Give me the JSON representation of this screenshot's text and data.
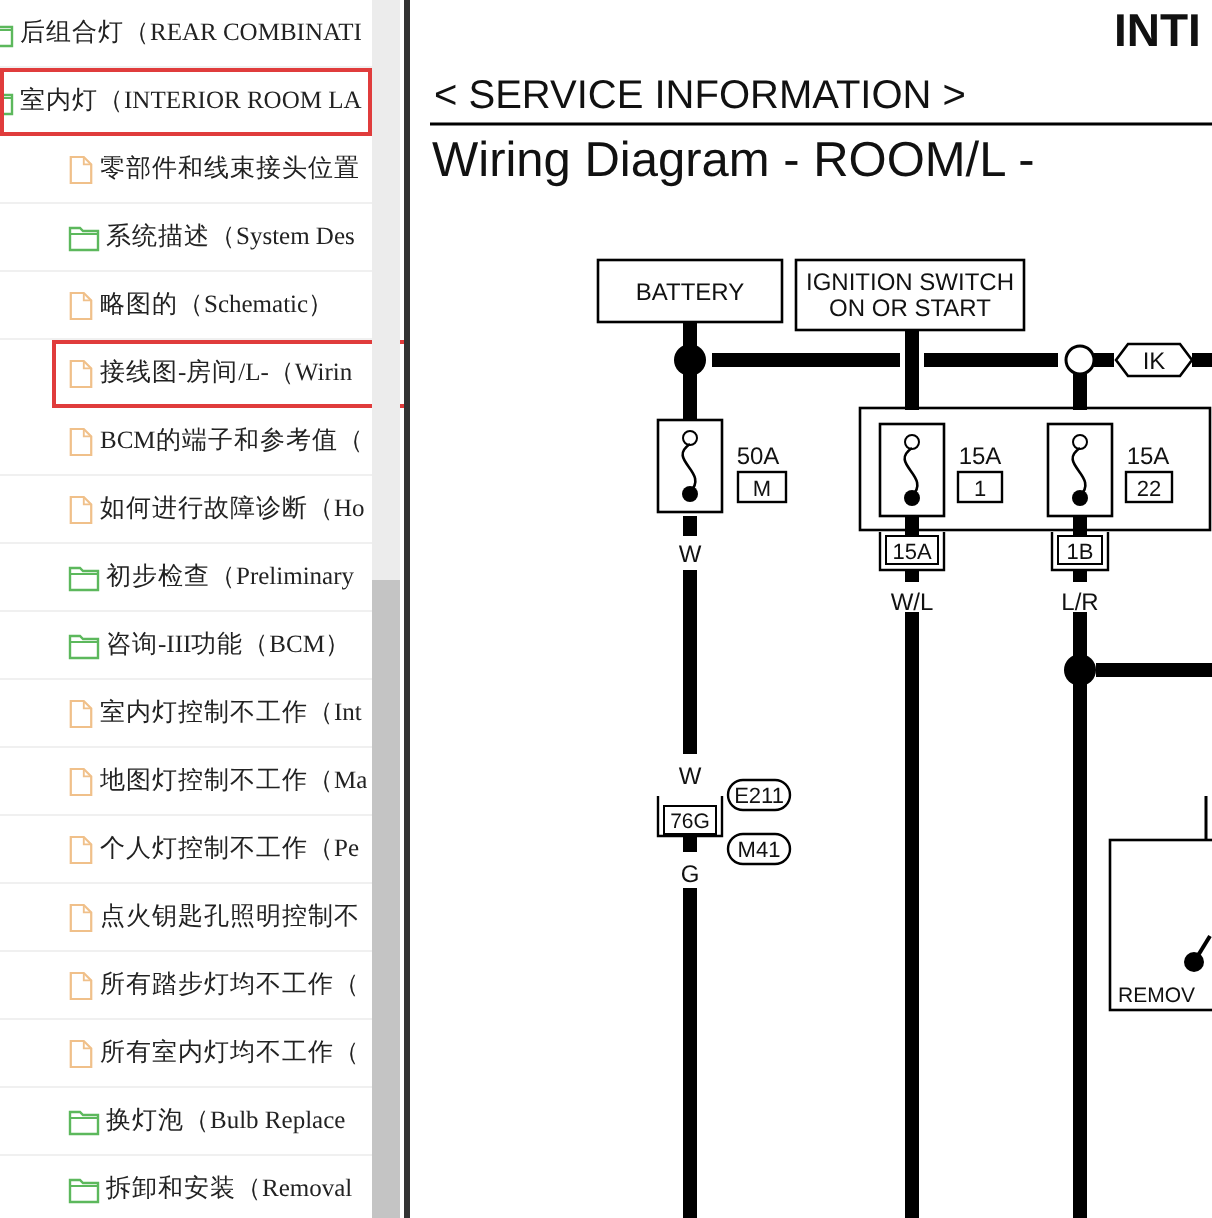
{
  "tree": [
    {
      "label": "后组合灯（REAR COMBINATI",
      "kind": "folder",
      "outlined": false
    },
    {
      "label": "室内灯（INTERIOR ROOM LA",
      "kind": "folder",
      "outlined": true,
      "children": [
        {
          "label": "零部件和线束接头位置",
          "kind": "document",
          "outlined": false
        },
        {
          "label": "系统描述（System Des",
          "kind": "folder",
          "outlined": false
        },
        {
          "label": "略图的（Schematic）",
          "kind": "document",
          "outlined": false
        },
        {
          "label": "接线图-房间/L-（Wirin",
          "kind": "document",
          "outlined": true
        },
        {
          "label": "BCM的端子和参考值（",
          "kind": "document",
          "outlined": false
        },
        {
          "label": "如何进行故障诊断（Ho",
          "kind": "document",
          "outlined": false
        },
        {
          "label": "初步检查（Preliminary",
          "kind": "folder",
          "outlined": false
        },
        {
          "label": "咨询-III功能（BCM）",
          "kind": "folder",
          "outlined": false
        },
        {
          "label": "室内灯控制不工作（Int",
          "kind": "document",
          "outlined": false
        },
        {
          "label": "地图灯控制不工作（Ma",
          "kind": "document",
          "outlined": false
        },
        {
          "label": "个人灯控制不工作（Pe",
          "kind": "document",
          "outlined": false
        },
        {
          "label": "点火钥匙孔照明控制不",
          "kind": "document",
          "outlined": false
        },
        {
          "label": "所有踏步灯均不工作（",
          "kind": "document",
          "outlined": false
        },
        {
          "label": "所有室内灯均不工作（",
          "kind": "document",
          "outlined": false
        },
        {
          "label": "换灯泡（Bulb Replace",
          "kind": "folder",
          "outlined": false
        },
        {
          "label": "拆卸和安装（Removal",
          "kind": "folder",
          "outlined": false
        }
      ]
    }
  ],
  "document": {
    "header": "INTI",
    "section": "< SERVICE INFORMATION >",
    "title": "Wiring Diagram - ROOM/L -",
    "diagram": {
      "battery": "BATTERY",
      "ignition_lines": [
        "IGNITION SWITCH",
        "ON OR START"
      ],
      "harness_connector": "IK",
      "fuses": [
        {
          "rating": "50A",
          "number": "M"
        },
        {
          "rating": "15A",
          "number": "1"
        },
        {
          "rating": "15A",
          "number": "22"
        }
      ],
      "terminals": [
        "15A",
        "1B"
      ],
      "wire_colors": [
        "W",
        "W/L",
        "L/R",
        "W",
        "G"
      ],
      "connector": "76G",
      "connector_ids": [
        "E211",
        "M41"
      ],
      "component_label": "REMOV"
    }
  }
}
